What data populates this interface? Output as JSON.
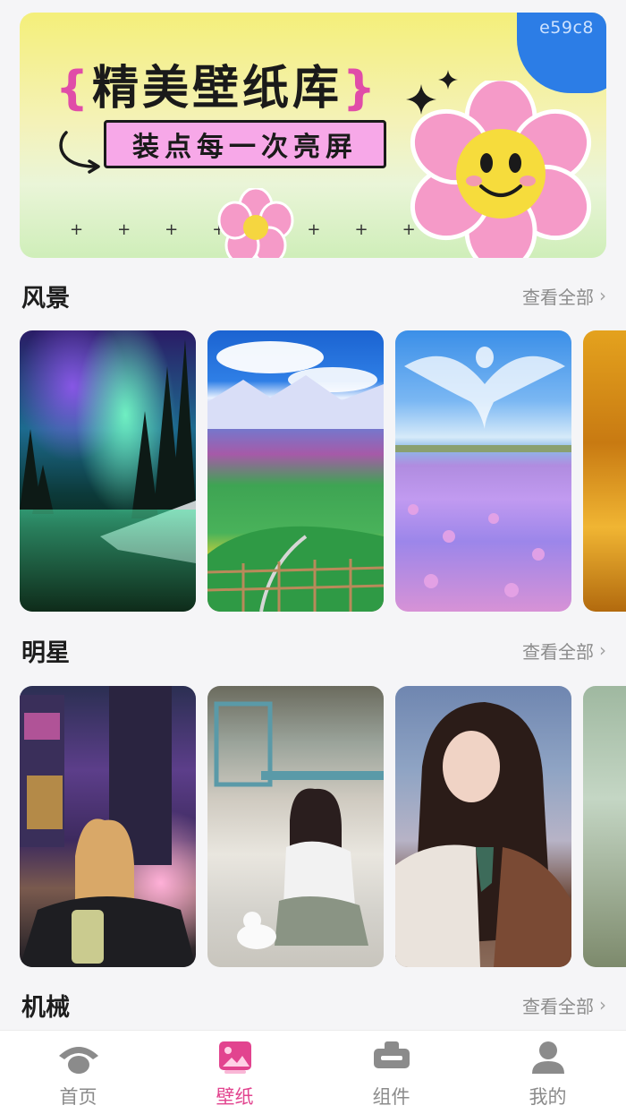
{
  "banner": {
    "title": "精美壁纸库",
    "subtitle": "装点每一次亮屏",
    "tag": "e59c8"
  },
  "sections": [
    {
      "title": "风景",
      "more": "查看全部",
      "cards": [
        "aurora-lake",
        "mountain-meadow",
        "lavender-field",
        "autumn-leaves"
      ]
    },
    {
      "title": "明星",
      "more": "查看全部",
      "cards": [
        "city-night-portrait",
        "anime-girl-cat",
        "girl-portrait",
        "green-portrait"
      ]
    },
    {
      "title": "机械",
      "more": "查看全部",
      "cards": []
    }
  ],
  "tabbar": {
    "items": [
      {
        "label": "首页",
        "icon": "home-icon"
      },
      {
        "label": "壁纸",
        "icon": "wallpaper-icon"
      },
      {
        "label": "组件",
        "icon": "widget-icon"
      },
      {
        "label": "我的",
        "icon": "profile-icon"
      }
    ],
    "active_index": 1,
    "active_color": "#e2448f",
    "inactive_color": "#8b8b8b"
  }
}
